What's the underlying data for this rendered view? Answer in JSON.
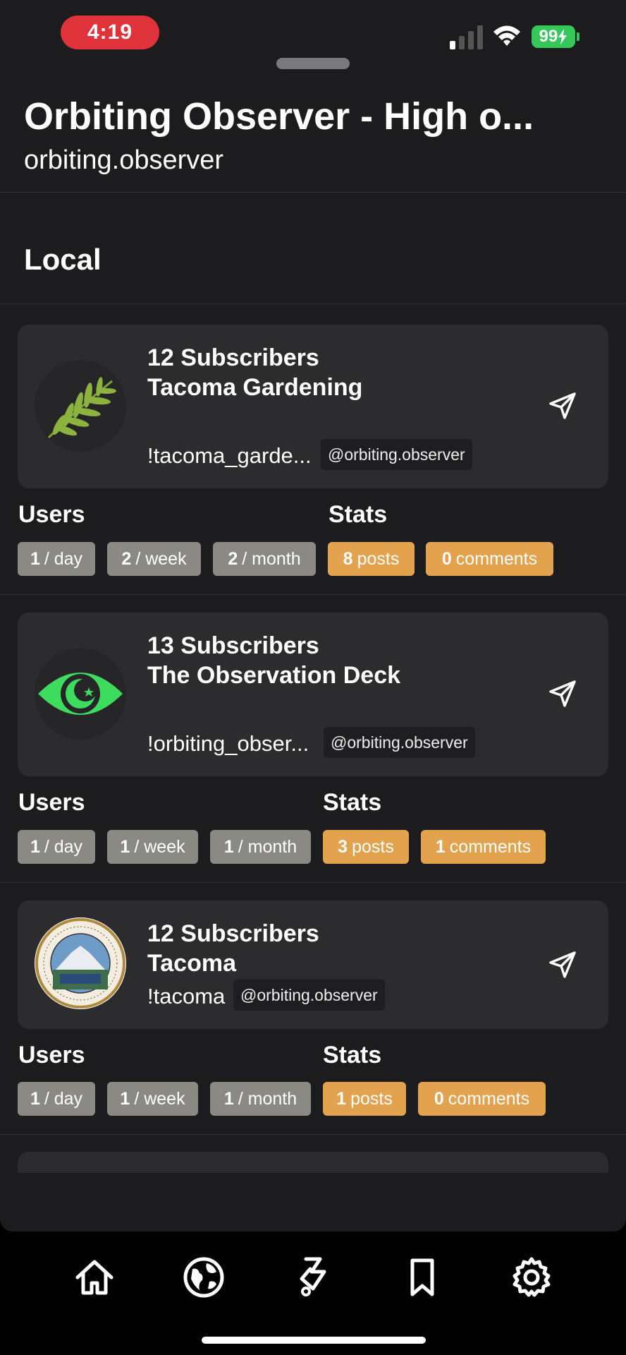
{
  "status_bar": {
    "time": "4:19",
    "battery": "99"
  },
  "header": {
    "title": "Orbiting Observer - High o...",
    "subtitle": "orbiting.observer"
  },
  "section_title": "Local",
  "communities": [
    {
      "subscribers": "12 Subscribers",
      "name": "Tacoma Gardening",
      "handle": "!tacoma_garde...",
      "instance": "@orbiting.observer",
      "users_label": "Users",
      "stats_label": "Stats",
      "users": [
        {
          "num": "1",
          "unit": "/ day"
        },
        {
          "num": "2",
          "unit": "/ week"
        },
        {
          "num": "2",
          "unit": "/ month"
        }
      ],
      "stats": [
        {
          "num": "8",
          "unit": "posts"
        },
        {
          "num": "0",
          "unit": "comments"
        }
      ]
    },
    {
      "subscribers": "13 Subscribers",
      "name": "The Observation Deck",
      "handle": "!orbiting_obser...",
      "instance": "@orbiting.observer",
      "users_label": "Users",
      "stats_label": "Stats",
      "users": [
        {
          "num": "1",
          "unit": "/ day"
        },
        {
          "num": "1",
          "unit": "/ week"
        },
        {
          "num": "1",
          "unit": "/ month"
        }
      ],
      "stats": [
        {
          "num": "3",
          "unit": "posts"
        },
        {
          "num": "1",
          "unit": "comments"
        }
      ]
    },
    {
      "subscribers": "12 Subscribers",
      "name": "Tacoma",
      "handle": "!tacoma",
      "instance": "@orbiting.observer",
      "users_label": "Users",
      "stats_label": "Stats",
      "users": [
        {
          "num": "1",
          "unit": "/ day"
        },
        {
          "num": "1",
          "unit": "/ week"
        },
        {
          "num": "1",
          "unit": "/ month"
        }
      ],
      "stats": [
        {
          "num": "1",
          "unit": "posts"
        },
        {
          "num": "0",
          "unit": "comments"
        }
      ]
    }
  ],
  "tabs": [
    "home-icon",
    "globe-icon",
    "explore-icon",
    "bookmark-icon",
    "gear-icon"
  ],
  "colors": {
    "gray_chip": "#8b8983",
    "orange_chip": "#e3a24e",
    "accent_green": "#3ddc5f",
    "time_pill": "#e0323a"
  }
}
